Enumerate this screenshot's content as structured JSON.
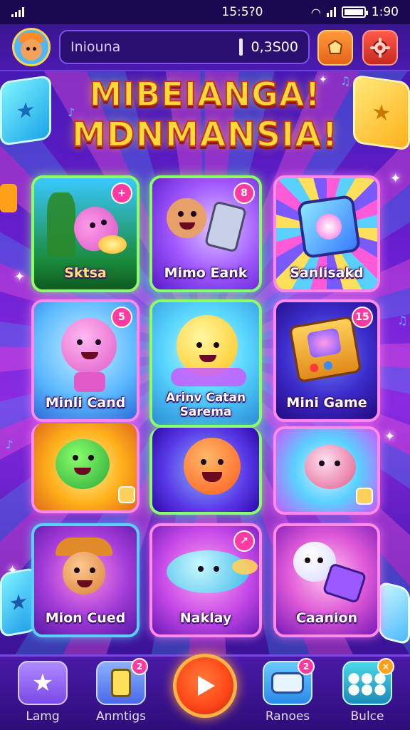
{
  "status_bar": {
    "time": "15:5?0",
    "clock_right": "1:90"
  },
  "top_bar": {
    "search_text": "Iniouna",
    "balance": "0,3S00"
  },
  "title": {
    "line1": "MIBEIANGA!",
    "line2": "MDNMANSIA!"
  },
  "games": [
    {
      "label": "Sktsa",
      "badge": "+"
    },
    {
      "label": "Mimo Eank",
      "badge": "8"
    },
    {
      "label": "Sanlisakd",
      "badge": ""
    },
    {
      "label": "Minli Cand",
      "badge": "5"
    },
    {
      "label": "Arinv Catan\nSarema",
      "badge": ""
    },
    {
      "label": "Mini Game",
      "badge": "15"
    },
    {
      "label": "",
      "badge": ""
    },
    {
      "label": "",
      "badge": ""
    },
    {
      "label": "",
      "badge": ""
    },
    {
      "label": "Mion Cued",
      "badge": ""
    },
    {
      "label": "Naklay",
      "badge": "↗"
    },
    {
      "label": "Caanion",
      "badge": ""
    }
  ],
  "bottom_nav": {
    "items": [
      {
        "label": "Lamg",
        "badge": ""
      },
      {
        "label": "Anmtigs",
        "badge": "2"
      },
      {
        "label": "Ranoes",
        "badge": "2"
      },
      {
        "label": "Bulce",
        "badge": "×"
      }
    ]
  },
  "colors": {
    "accent_pink": "#ff3aa0",
    "title_yellow": "#ffd83a",
    "play_orange": "#ff4a1a",
    "nav_bg": "#2e0d7a"
  }
}
